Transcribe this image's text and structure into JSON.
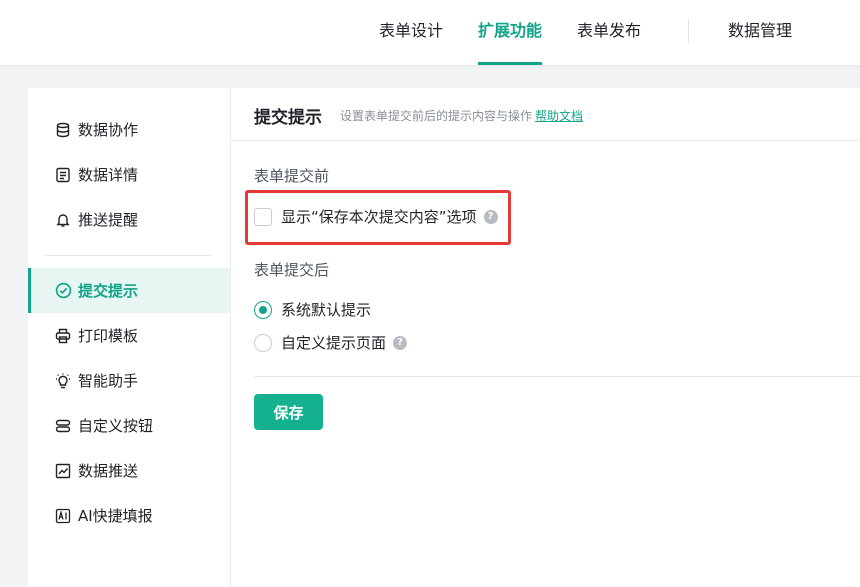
{
  "topnav": {
    "tabs": [
      {
        "label": "表单设计",
        "active": false
      },
      {
        "label": "扩展功能",
        "active": true
      },
      {
        "label": "表单发布",
        "active": false
      },
      {
        "label": "数据管理",
        "active": false
      }
    ]
  },
  "sidebar": {
    "items": [
      {
        "label": "数据协作",
        "icon": "database-icon"
      },
      {
        "label": "数据详情",
        "icon": "detail-list-icon"
      },
      {
        "label": "推送提醒",
        "icon": "bell-icon"
      },
      {
        "label": "提交提示",
        "icon": "check-circle-icon",
        "active": true
      },
      {
        "label": "打印模板",
        "icon": "printer-icon"
      },
      {
        "label": "智能助手",
        "icon": "lightbulb-icon"
      },
      {
        "label": "自定义按钮",
        "icon": "custom-button-icon"
      },
      {
        "label": "数据推送",
        "icon": "line-chart-icon"
      },
      {
        "label": "AI快捷填报",
        "icon": "ai-icon"
      }
    ]
  },
  "panel": {
    "title": "提交提示",
    "description": "设置表单提交前后的提示内容与操作",
    "help_link": "帮助文档",
    "before_label": "表单提交前",
    "before_option": {
      "label": "显示“保存本次提交内容”选项",
      "checked": false
    },
    "after_label": "表单提交后",
    "after_options": [
      {
        "label": "系统默认提示",
        "checked": true
      },
      {
        "label": "自定义提示页面",
        "checked": false
      }
    ],
    "save_label": "保存"
  },
  "colors": {
    "accent": "#12a58a",
    "highlight_box": "#e53935"
  }
}
